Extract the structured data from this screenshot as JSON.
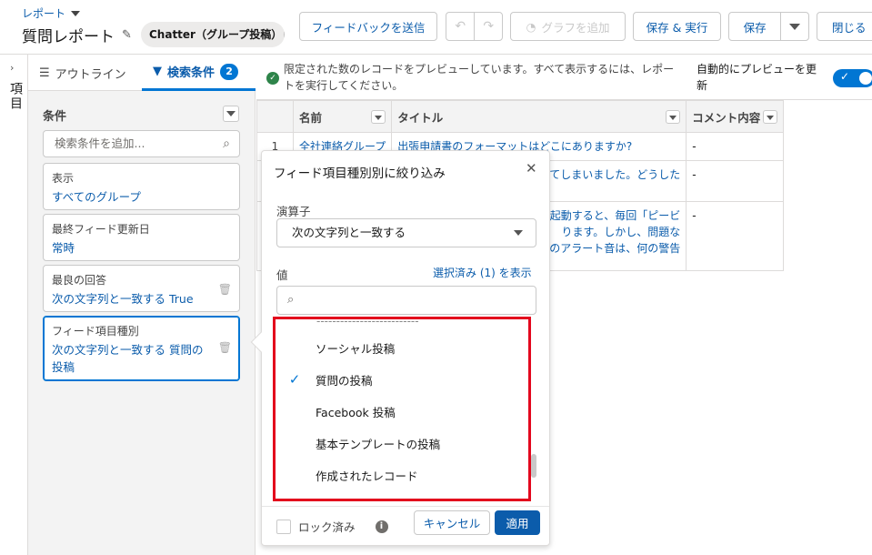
{
  "header": {
    "breadcrumb": "レポート",
    "title": "質問レポート",
    "report_type": "Chatter（グループ投稿）レ",
    "feedback_label": "フィードバックを送信",
    "undo_icon": "↶",
    "redo_icon": "↷",
    "add_chart_label": "グラフを追加",
    "save_run_label": "保存 & 実行",
    "save_label": "保存",
    "close_label": "閉じる"
  },
  "rail": {
    "label": "項目",
    "arrow": "›"
  },
  "panel": {
    "tab_outline": "アウトライン",
    "tab_filters": "検索条件",
    "filter_count": "2",
    "section_title": "条件",
    "search_placeholder": "検索条件を追加...",
    "filters": [
      {
        "label": "表示",
        "value": "すべてのグループ"
      },
      {
        "label": "最終フィード更新日",
        "value": "常時"
      },
      {
        "label": "最良の回答",
        "value": "次の文字列と一致する True"
      },
      {
        "label": "フィード項目種別",
        "value": "次の文字列と一致する 質問の投稿"
      }
    ]
  },
  "notice": {
    "message": "限定された数のレコードをプレビューしています。すべて表示するには、レポートを実行してください。",
    "auto_preview": "自動的にプレビューを更新"
  },
  "table": {
    "columns": [
      "名前",
      "タイトル",
      "コメント内容"
    ],
    "rows": [
      {
        "num": "1",
        "name": "全社連絡グループ",
        "title": "出張申請書のフォーマットはどこにありますか?",
        "comment": "-"
      },
      {
        "num": "",
        "name": "",
        "title": "てしまいました。どうした",
        "comment": "-"
      },
      {
        "num": "",
        "name": "",
        "title": "起動すると、毎回「ピービ\nります。しかし、問題な\nのアラート音は、何の警告",
        "comment": "-"
      }
    ]
  },
  "popover": {
    "title": "フィード項目種別別に絞り込み",
    "close": "✕",
    "operator_label": "演算子",
    "operator_value": "次の文字列と一致する",
    "value_label": "値",
    "show_selected": "選択済み (1) を表示",
    "options": [
      {
        "label": "ソーシャル投稿",
        "checked": false
      },
      {
        "label": "質問の投稿",
        "checked": true
      },
      {
        "label": "Facebook 投稿",
        "checked": false
      },
      {
        "label": "基本テンプレートの投稿",
        "checked": false
      },
      {
        "label": "作成されたレコード",
        "checked": false
      }
    ],
    "locked_label": "ロック済み",
    "cancel_label": "キャンセル",
    "apply_label": "適用"
  },
  "colors": {
    "brand": "#0176d3",
    "link": "#0b5cab",
    "highlight": "#e3071d",
    "success": "#2e844a"
  }
}
